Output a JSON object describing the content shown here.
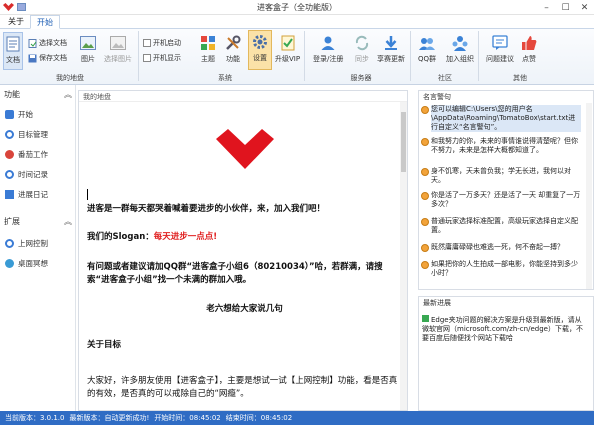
{
  "window": {
    "title": "进客盒子（全功能版）",
    "minimize": "–",
    "maximize": "☐",
    "close": "✕"
  },
  "tabs": [
    {
      "label": "关于"
    },
    {
      "label": "开始"
    }
  ],
  "ribbon": {
    "groups": [
      {
        "label": "我的地盘"
      },
      {
        "label": "系统"
      },
      {
        "label": "服务器"
      },
      {
        "label": "社区"
      },
      {
        "label": "其他"
      }
    ],
    "buttons": {
      "doc": "文档",
      "select_doc": "选择文档",
      "save_doc": "保存文档",
      "image": "图片",
      "select_image": "选择图片",
      "autostart": "开机启动",
      "boot_show": "开机显示",
      "theme": "主题",
      "function": "功能",
      "settings": "设置",
      "upgrade": "升级VIP",
      "login": "登录/注册",
      "sync": "同步",
      "share": "享赛更新",
      "qq_group": "QQ群",
      "join_org": "加入组织",
      "feedback": "问题建议",
      "like": "点赞"
    }
  },
  "nav": {
    "section1": "功能",
    "section2": "扩展",
    "items": [
      {
        "label": "开始",
        "color": "#3a7bd5"
      },
      {
        "label": "目标管理",
        "color": "#3a7bd5"
      },
      {
        "label": "番茄工作",
        "color": "#d9453b"
      },
      {
        "label": "时间记录",
        "color": "#3a7bd5"
      },
      {
        "label": "进展日记",
        "color": "#3a7bd5"
      }
    ],
    "ext_items": [
      {
        "label": "上网控制",
        "color": "#3a7bd5"
      },
      {
        "label": "桌面冥想",
        "color": "#3a9bd5"
      }
    ]
  },
  "main": {
    "header": "我的地盘",
    "line1": "进客是一群每天都哭着喊着要进步的小伙伴，来，加入我们吧！",
    "slogan_prefix": "我们的Slogan：",
    "slogan": "每天进步一点点!",
    "qq_text": "有问题或者建议请加QQ群“进客盒子小组6（80210034）”哈，若群满，请搜索“进客盒子小组”找一个未满的群加入哦。",
    "subtitle": "老六想给大家说几句",
    "goal_title": "关于目标",
    "para": "大家好，许多朋友使用【进客盒子】，主要是想试一试【上网控制】功能，看是否真的有效，是否真的可以戒除自己的“网瘾”。"
  },
  "right": {
    "quotes_header": "名言警句",
    "quotes": [
      "您可以编辑C:\\Users\\您的用户名\\AppData\\Roaming\\TomatoBox\\start.txt进行自定义“名言警句”。",
      "和我努力的你，未来的事情谁说得清楚呢？但你不努力，未来是怎样大概都知道了。",
      "身不饥寒，天未曾负我；学无长进，我何以对天。",
      "你是活了一万多天？还是活了一天 却重复了一万多次？",
      "普通玩家选择标准配置，高级玩家选择自定义配置。",
      "既然庸庸碌碌也难逃一死，何不奋起一搏？",
      "如果把你的人生拍成一部电影，你能坚持到多少小时？"
    ],
    "news_header": "最新进展",
    "news": "Edge夹功问题的解决方案是升级到最新版，请从微软官网（microsoft.com/zh-cn/edge）下载，不要百度后随便找个网站下载哈"
  },
  "status": {
    "version": "当前版本：3.0.1.0",
    "autoupdate": "最新版本：自动更新成功!",
    "start_time": "开始时间：08:45:02",
    "end_time": "结束时间：08:45:02"
  }
}
